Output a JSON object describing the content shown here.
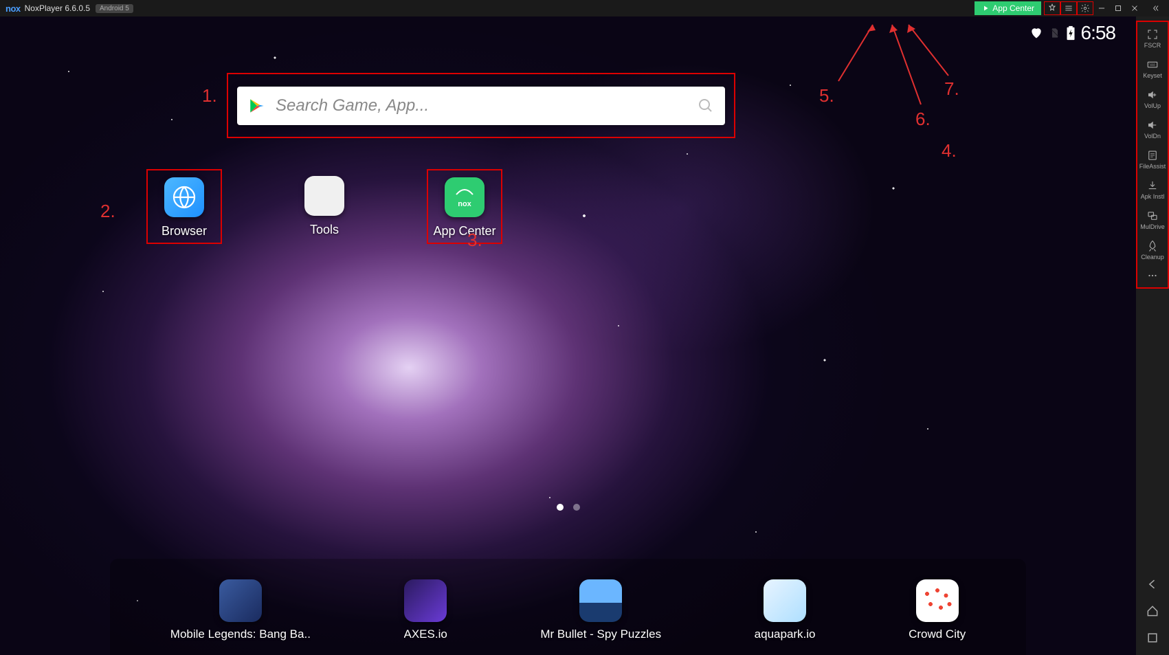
{
  "titlebar": {
    "logo": "nox",
    "appname": "NoxPlayer 6.6.0.5",
    "android_badge": "Android 5",
    "appcenter_btn": "App Center"
  },
  "status": {
    "time": "6:58"
  },
  "search": {
    "placeholder": "Search Game, App..."
  },
  "apps": [
    {
      "label": "Browser"
    },
    {
      "label": "Tools"
    },
    {
      "label": "App Center"
    }
  ],
  "dock": [
    {
      "label": "Mobile Legends: Bang Ba..",
      "bg": "linear-gradient(135deg,#3a5b9f,#1a2b5f)"
    },
    {
      "label": "AXES.io",
      "bg": "linear-gradient(135deg,#2b1a5f,#6a3bd6)"
    },
    {
      "label": "Mr Bullet - Spy Puzzles",
      "bg": "linear-gradient(180deg,#6bb6ff 0%,#6bb6ff 55%,#1a3b6f 55%)"
    },
    {
      "label": "aquapark.io",
      "bg": "linear-gradient(135deg,#e8f4ff,#aedfff)"
    },
    {
      "label": "Crowd City",
      "bg": "#fff"
    }
  ],
  "right_toolbar": [
    {
      "label": "FSCR",
      "icon": "fullscreen"
    },
    {
      "label": "Keyset",
      "icon": "keyboard"
    },
    {
      "label": "VolUp",
      "icon": "volup"
    },
    {
      "label": "VolDn",
      "icon": "voldn"
    },
    {
      "label": "FileAssist",
      "icon": "file"
    },
    {
      "label": "Apk Instl",
      "icon": "apk"
    },
    {
      "label": "MulDrive",
      "icon": "multi"
    },
    {
      "label": "Cleanup",
      "icon": "rocket"
    }
  ],
  "annotations": {
    "a1": "1.",
    "a2": "2.",
    "a3": "3.",
    "a4": "4.",
    "a5": "5.",
    "a6": "6.",
    "a7": "7."
  }
}
